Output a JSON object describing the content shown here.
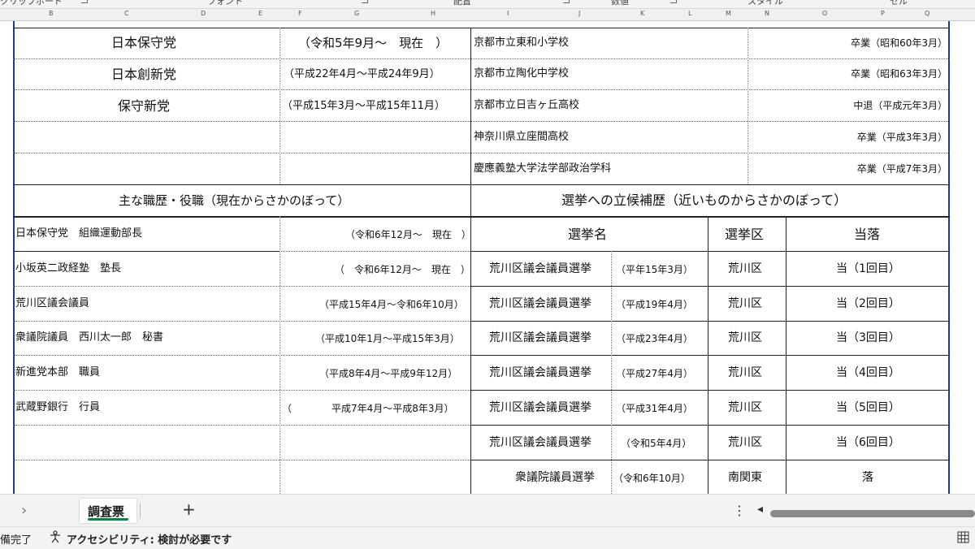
{
  "ribbon": {
    "groups": [
      "クリップボード",
      "フォント",
      "配置",
      "数値",
      "スタイル",
      "セル"
    ]
  },
  "columns": [
    "B",
    "C",
    "D",
    "E",
    "F",
    "G",
    "H",
    "I",
    "J",
    "K",
    "L",
    "M",
    "N",
    "O",
    "P",
    "Q"
  ],
  "parties": [
    {
      "name": "日本保守党",
      "period": "（令和5年9月～　現在　）"
    },
    {
      "name": "日本創新党",
      "period": "（平成22年4月～平成24年9月）"
    },
    {
      "name": "保守新党",
      "period": "（平成15年3月～平成15年11月）"
    }
  ],
  "education": [
    {
      "school": "京都市立東和小学校",
      "status": "卒業（昭和60年3月）"
    },
    {
      "school": "京都市立陶化中学校",
      "status": "卒業（昭和63年3月）"
    },
    {
      "school": "京都市立日吉ヶ丘高校",
      "status": "中退（平成元年3月）"
    },
    {
      "school": "神奈川県立座間高校",
      "status": "卒業（平成3年3月）"
    },
    {
      "school": "慶應義塾大学法学部政治学科",
      "status": "卒業（平成7年3月）"
    }
  ],
  "career": {
    "title": "主な職歴・役職（現在からさかのぼって）",
    "rows": [
      {
        "role": "日本保守党　組織運動部長",
        "period": "（令和6年12月～　現在　）"
      },
      {
        "role": "小坂英二政経塾　塾長",
        "period": "（　令和6年12月～　現在　）"
      },
      {
        "role": "荒川区議会議員",
        "period": "（平成15年4月～令和6年10月）"
      },
      {
        "role": "衆議院議員　西川太一郎　秘書",
        "period": "（平成10年1月～平成15年3月）"
      },
      {
        "role": "新進党本部　職員",
        "period": "（平成8年4月～平成9年12月）"
      },
      {
        "role": "武蔵野銀行　行員",
        "period_open": "（",
        "period": "平成7年4月～平成8年3月）"
      }
    ]
  },
  "elections": {
    "title": "選挙への立候補歴（近いものからさかのぼって）",
    "headers": [
      "選挙名",
      "選挙区",
      "当落"
    ],
    "rows": [
      {
        "name": "荒川区議会議員選挙",
        "date": "（平年15年3月）",
        "district": "荒川区",
        "result": "当（1回目）"
      },
      {
        "name": "荒川区議会議員選挙",
        "date": "（平成19年4月）",
        "district": "荒川区",
        "result": "当（2回目）"
      },
      {
        "name": "荒川区議会議員選挙",
        "date": "（平成23年4月）",
        "district": "荒川区",
        "result": "当（3回目）"
      },
      {
        "name": "荒川区議会議員選挙",
        "date": "（平成27年4月）",
        "district": "荒川区",
        "result": "当（4回目）"
      },
      {
        "name": "荒川区議会議員選挙",
        "date": "（平成31年4月）",
        "district": "荒川区",
        "result": "当（5回目）"
      },
      {
        "name": "荒川区議会議員選挙",
        "date": "（令和5年4月）",
        "district": "荒川区",
        "result": "当（6回目）"
      },
      {
        "name": "衆議院議員選挙",
        "date": "（令和6年10月）",
        "district": "南関東",
        "result": "落"
      }
    ]
  },
  "sheet_tabs": {
    "active": "調査票",
    "add": "+",
    "prev": "›",
    "more": "⋮",
    "scroll_left": "◂"
  },
  "status": {
    "ready": "備完了",
    "accessibility": "アクセシビリティ: 検討が必要です"
  }
}
